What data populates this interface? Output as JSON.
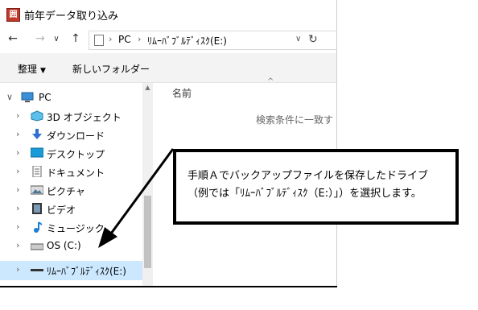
{
  "window": {
    "title": "前年データ取り込み",
    "app_icon_glyph": "囲"
  },
  "address": {
    "back_icon": "←",
    "forward_icon": "→",
    "recent_icon": "∨",
    "up_icon": "↑",
    "separator": "›",
    "path": [
      "PC",
      "ﾘﾑｰﾊﾞﾌﾞﾙﾃﾞｨｽｸ(E:)"
    ],
    "dropdown_icon": "∨",
    "refresh_icon": "↻"
  },
  "toolbar": {
    "organize_label": "整理",
    "organize_caret": "▼",
    "new_folder_label": "新しいフォルダー"
  },
  "navigation": {
    "items": [
      {
        "label": "PC",
        "icon": "pc-icon",
        "expanded": true,
        "level": 0
      },
      {
        "label": "3D オブジェクト",
        "icon": "3d-objects-icon",
        "level": 1
      },
      {
        "label": "ダウンロード",
        "icon": "download-icon",
        "level": 1
      },
      {
        "label": "デスクトップ",
        "icon": "desktop-icon",
        "level": 1
      },
      {
        "label": "ドキュメント",
        "icon": "documents-icon",
        "level": 1
      },
      {
        "label": "ピクチャ",
        "icon": "pictures-icon",
        "level": 1
      },
      {
        "label": "ビデオ",
        "icon": "videos-icon",
        "level": 1
      },
      {
        "label": "ミュージック",
        "icon": "music-icon",
        "level": 1
      },
      {
        "label": "OS (C:)",
        "icon": "drive-icon",
        "level": 1
      },
      {
        "label": "ﾘﾑｰﾊﾞﾌﾞﾙﾃﾞｨｽｸ(E:)",
        "icon": "removable-drive-icon",
        "level": 0,
        "selected": true
      }
    ],
    "collapse_icon": "∨",
    "expand_icon": "›"
  },
  "content": {
    "column_header": "名前",
    "sort_indicator": "^",
    "empty_message": "検索条件に一致す"
  },
  "callout": {
    "line1": "手順Ａでバックアップファイルを保存したドライブ",
    "line2": "（例では「ﾘﾑｰﾊﾞﾌﾞﾙﾃﾞｨｽｸ（E:）」）を選択します。"
  },
  "colors": {
    "selected_bg": "#cce8ff",
    "toolbar_bg": "#f3f3f3",
    "app_icon": "#c0392b"
  }
}
